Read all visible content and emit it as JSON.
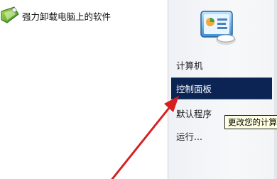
{
  "left_panel": {
    "program": {
      "label": "强力卸载电脑上的软件",
      "icon": "uninstall-program-icon"
    }
  },
  "right_panel": {
    "top_icon": "control-panel-icon",
    "menu": [
      {
        "label": "计算机",
        "selected": false
      },
      {
        "label": "控制面板",
        "selected": true
      },
      {
        "label": "默认程序",
        "selected": false
      },
      {
        "label": "运行...",
        "selected": false
      }
    ]
  },
  "tooltip": {
    "text": "更改您的计算"
  },
  "annotation": {
    "arrow_color": "#d62020"
  }
}
